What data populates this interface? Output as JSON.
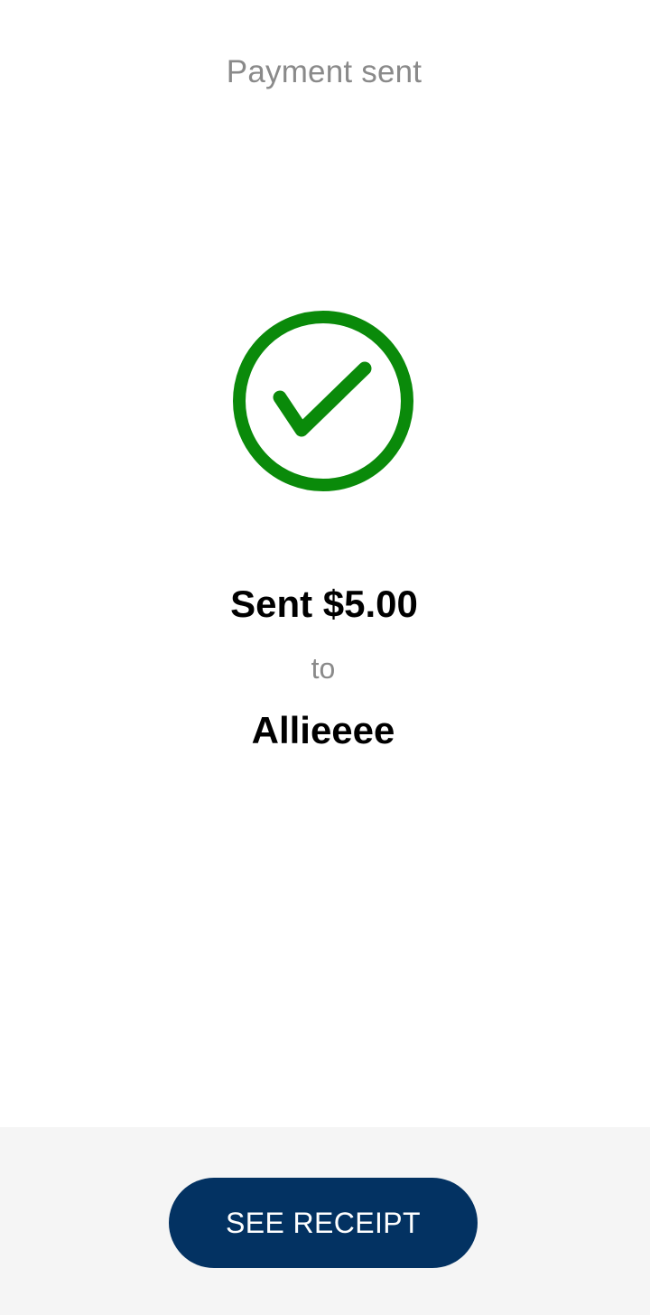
{
  "header": {
    "title": "Payment sent"
  },
  "status": {
    "icon": "check-circle-icon",
    "color": "#0a8a0a"
  },
  "payment": {
    "amount_text": "Sent $5.00",
    "connector": "to",
    "recipient": "Allieeee"
  },
  "footer": {
    "button_label": "SEE RECEIPT",
    "button_color": "#033262",
    "background": "#f5f5f5"
  }
}
